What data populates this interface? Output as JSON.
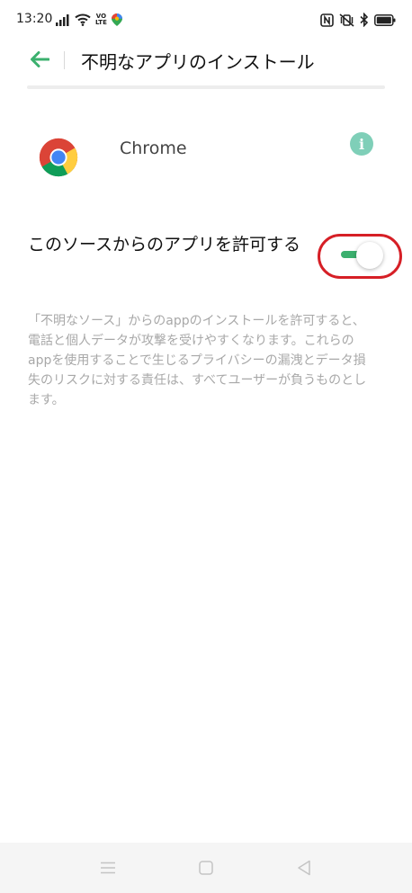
{
  "status_bar": {
    "time": "13:20",
    "left_icons": [
      "signal-icon",
      "wifi-icon",
      "volte-icon",
      "maps-notification-icon"
    ],
    "volte_text": [
      "VO",
      "LTE"
    ],
    "right_icons": [
      "nfc-icon",
      "vibrate-icon",
      "bluetooth-icon",
      "battery-icon"
    ]
  },
  "header": {
    "title": "不明なアプリのインストール",
    "back_icon": "back-arrow-icon"
  },
  "app": {
    "name": "Chrome",
    "icon": "chrome-icon",
    "info_icon": "info-icon",
    "info_glyph": "i"
  },
  "allow_setting": {
    "label": "このソースからのアプリを許可する",
    "toggle_state": "on"
  },
  "warning": "「不明なソース」からのappのインストールを許可すると、電話と個人データが攻撃を受けやすくなります。これらのappを使用することで生じるプライバシーの漏洩とデータ損失のリスクに対する責任は、すべてユーザーが負うものとします。",
  "navigation_bar": {
    "buttons": [
      "menu-icon",
      "home-icon",
      "back-icon"
    ]
  },
  "colors": {
    "accent": "#3bb06e",
    "info": "#7fcfb8",
    "highlight": "#d61f26",
    "warning_text": "#a8a8a8"
  }
}
